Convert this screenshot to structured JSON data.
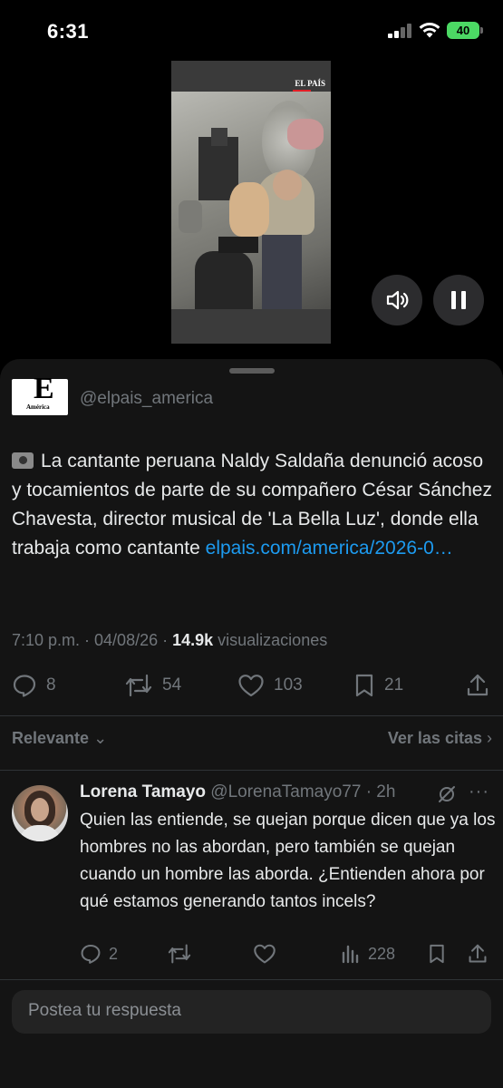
{
  "status_bar": {
    "time": "6:31",
    "battery": "40"
  },
  "video": {
    "watermark": "EL PAÍS"
  },
  "post": {
    "avatar_big": "E",
    "avatar_small": "América",
    "handle": "@elpais_america",
    "text": "La cantante peruana Naldy Saldaña denunció acoso y tocamientos de parte de su compañero César Sánchez Chavesta, director musical de 'La Bella Luz', donde ella trabaja como cantante ",
    "link": "elpais.com/america/2026-0…",
    "time": "7:10 p.m. · 04/08/26 · ",
    "views": "14.9k",
    "views_label": " visualizaciones",
    "replies": "8",
    "reposts": "54",
    "likes": "103",
    "bookmarks": "21"
  },
  "sort": {
    "left": "Relevante",
    "right": "Ver las citas"
  },
  "reply": {
    "name": "Lorena Tamayo",
    "handle_time": " @LorenaTamayo77 · 2h",
    "text": "Quien las entiende, se quejan porque dicen que ya los hombres no las abordan, pero también se quejan cuando un hombre las aborda. ¿Entienden ahora por qué estamos generando tantos incels?",
    "replies": "2",
    "views": "228",
    "more": "···"
  },
  "composer": {
    "placeholder": "Postea tu respuesta"
  }
}
